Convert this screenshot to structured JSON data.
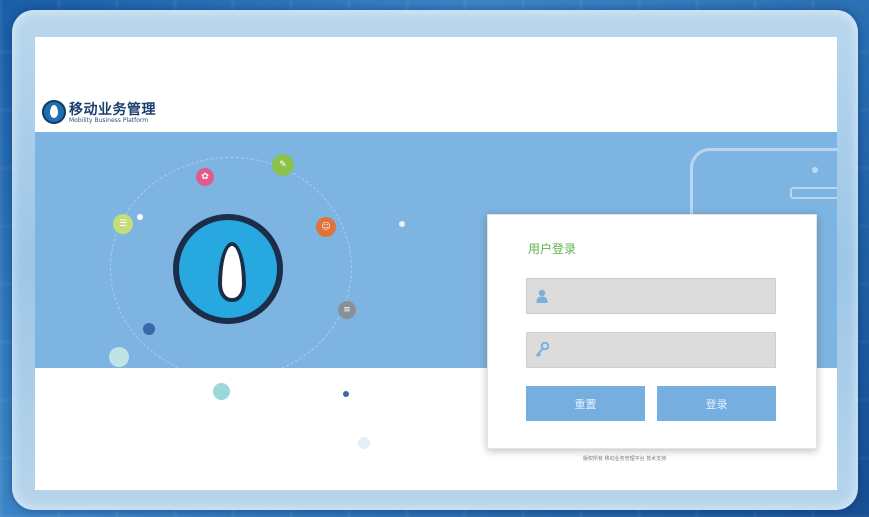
{
  "app": {
    "title": "移动业务管理",
    "subtitle": "Mobility Business Platform"
  },
  "login": {
    "heading": "用户登录",
    "username_placeholder": "",
    "password_placeholder": "",
    "reset_label": "重置",
    "login_label": "登录"
  },
  "footer": {
    "note": "版权所有 移动业务管理平台 技术支持"
  },
  "icons": {
    "logo": "flame-logo-icon",
    "user": "user-icon",
    "key": "key-icon"
  },
  "colors": {
    "banner": "#7eb4e1",
    "heading": "#5fb44f",
    "button": "#75aedf",
    "main_circle": "#27a8e0"
  }
}
